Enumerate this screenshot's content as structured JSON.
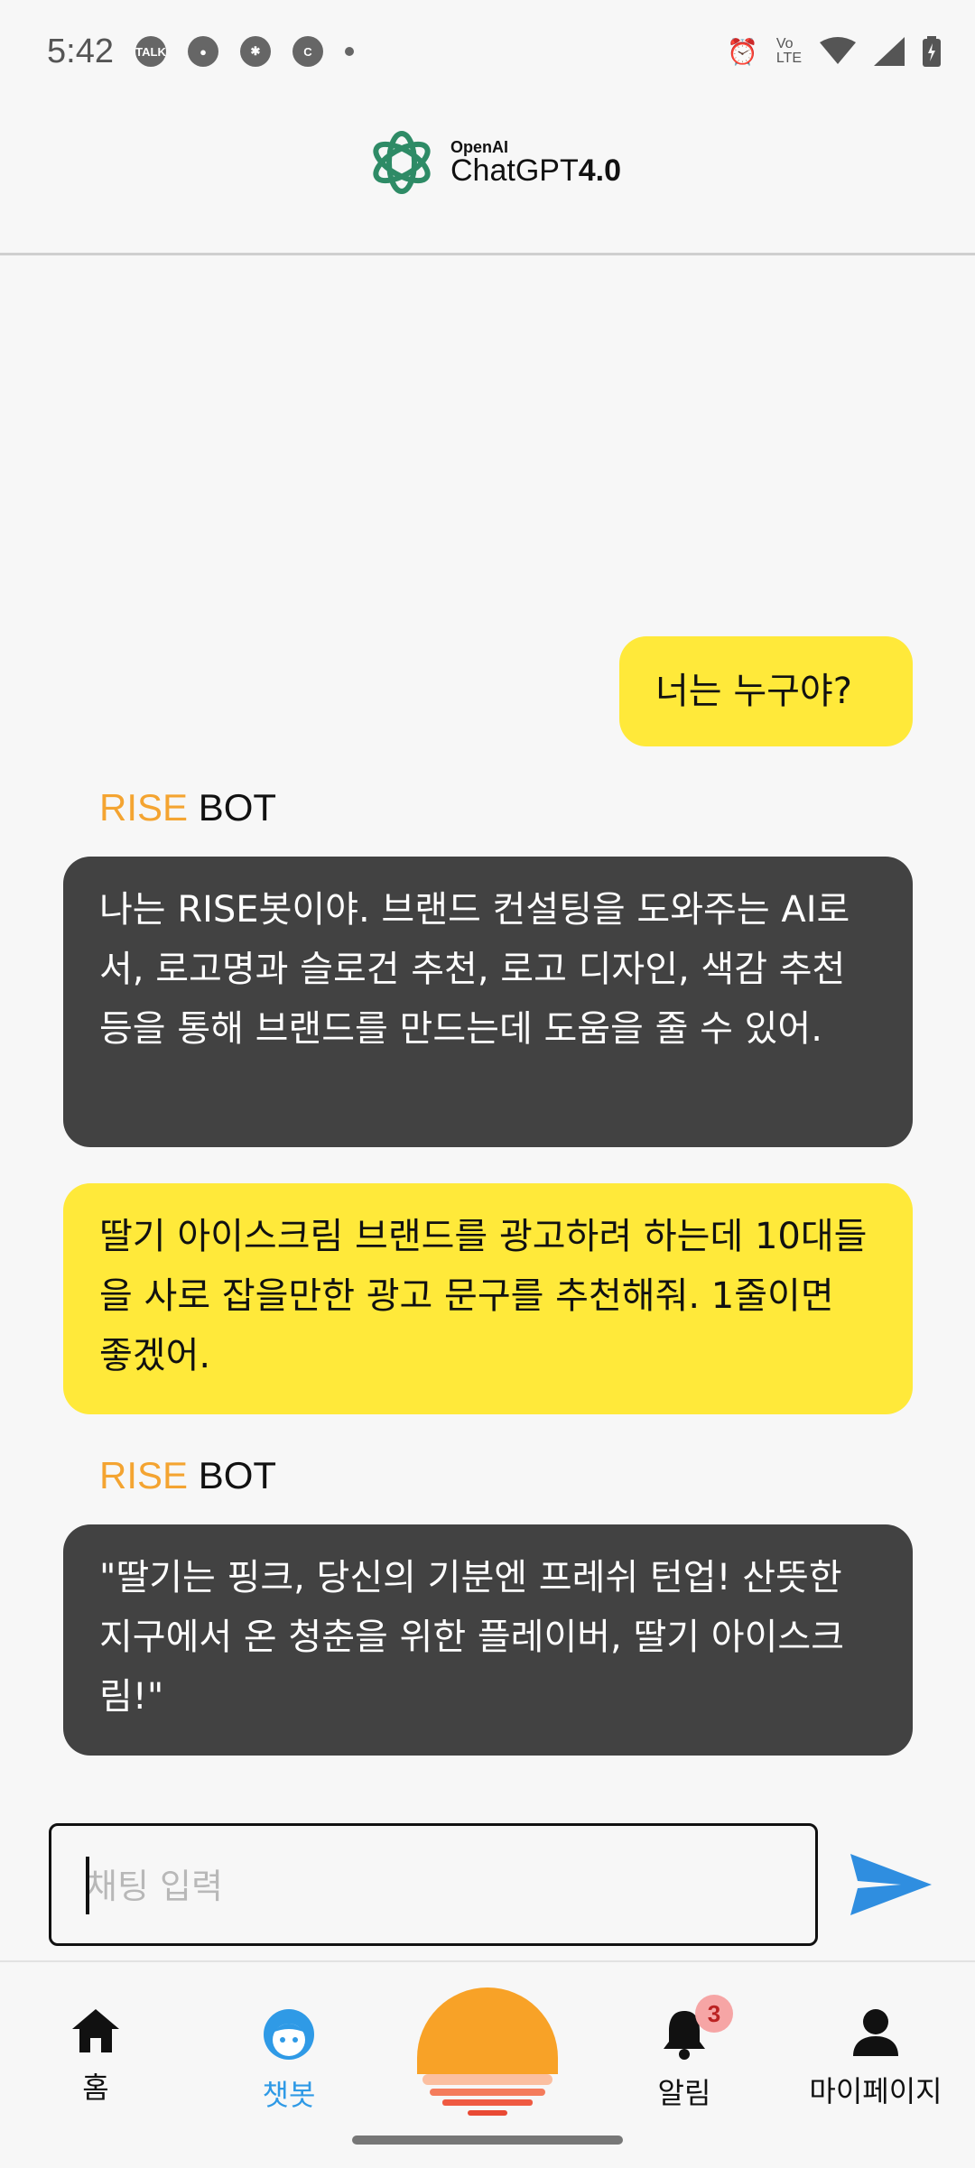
{
  "status_bar": {
    "time": "5:42",
    "left_icons": [
      "talk-icon",
      "message-icon",
      "slack-icon",
      "c-icon",
      "dot-icon"
    ],
    "right_icons": [
      "alarm-icon",
      "volte-icon",
      "wifi-icon",
      "signal-icon",
      "battery-icon"
    ]
  },
  "header": {
    "brand_small": "OpenAI",
    "brand_main": "ChatGPT",
    "brand_version": "4.0"
  },
  "messages": [
    {
      "role": "user",
      "text": "너는 누구야?"
    },
    {
      "role": "bot",
      "sender_prefix": "RISE",
      "sender_suffix": "BOT",
      "text": "나는 RISE봇이야. 브랜드 컨설팅을 도와주는 AI로서, 로고명과 슬로건 추천, 로고 디자인, 색감 추천 등을 통해 브랜드를 만드는데 도움을 줄 수 있어."
    },
    {
      "role": "user",
      "text": "딸기 아이스크림 브랜드를 광고하려 하는데 10대들을 사로 잡을만한 광고 문구를 추천해줘. 1줄이면 좋겠어."
    },
    {
      "role": "bot",
      "sender_prefix": "RISE",
      "sender_suffix": "BOT",
      "text": "\"딸기는 핑크, 당신의 기분엔 프레쉬 턴업! 산뜻한 지구에서 온 청춘을 위한 플레이버, 딸기 아이스크림!\""
    }
  ],
  "input": {
    "placeholder": "채팅 입력",
    "value": ""
  },
  "nav": {
    "home": "홈",
    "chatbot": "챗봇",
    "alarm": "알림",
    "alarm_badge": "3",
    "mypage": "마이페이지"
  },
  "colors": {
    "user_bubble": "#ffe93a",
    "bot_bubble": "#424242",
    "rise_orange": "#f4a431",
    "active_blue": "#2f9ae6",
    "send_blue": "#2f8ee0"
  }
}
